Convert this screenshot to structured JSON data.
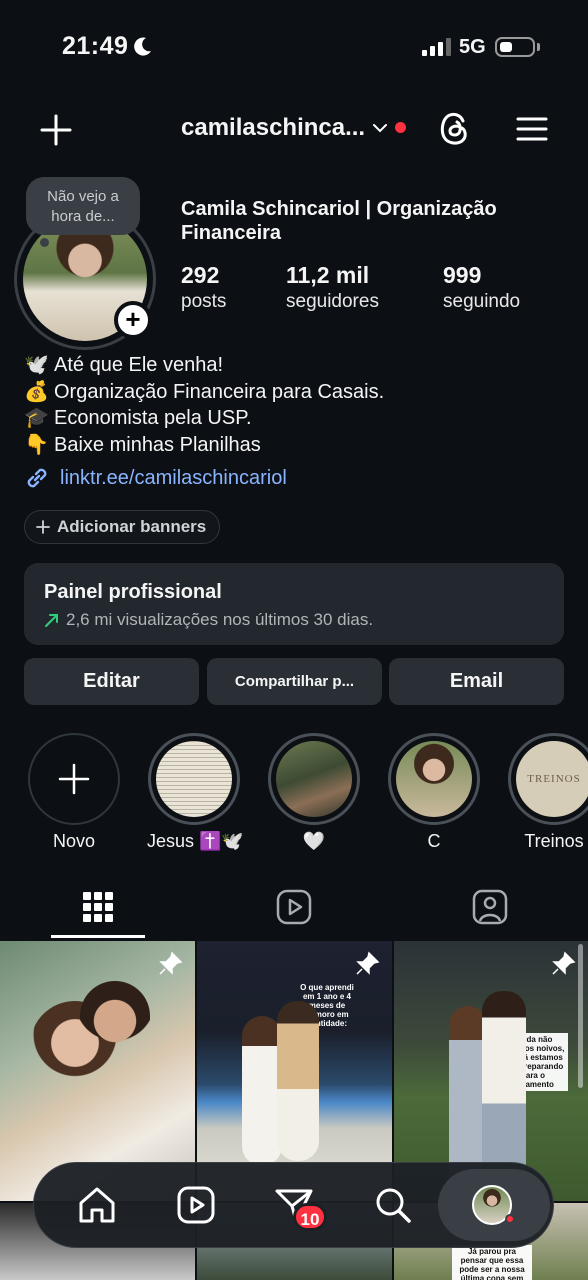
{
  "status": {
    "time": "21:49",
    "network": "5G"
  },
  "header": {
    "username": "camilaschinca..."
  },
  "profile": {
    "note": "Não vejo a hora de...",
    "display_name": "Camila Schincariol | Organização Financeira",
    "stats": [
      {
        "value": "292",
        "label": "posts"
      },
      {
        "value": "11,2 mil",
        "label": "seguidores"
      },
      {
        "value": "999",
        "label": "seguindo"
      }
    ],
    "bio": [
      {
        "emoji": "🕊️",
        "text": "Até que Ele venha!"
      },
      {
        "emoji": "💰",
        "text": "Organização Financeira para Casais."
      },
      {
        "emoji": "🎓",
        "text": "Economista pela USP."
      },
      {
        "emoji": "👇",
        "text": "Baixe minhas Planilhas"
      }
    ],
    "link": "linktr.ee/camilaschincariol",
    "add_banners": "Adicionar banners"
  },
  "pro_panel": {
    "title": "Painel profissional",
    "subtitle": "2,6 mi visualizações nos últimos 30 dias."
  },
  "actions": {
    "edit": "Editar",
    "share": "Compartilhar p...",
    "email": "Email"
  },
  "highlights": [
    {
      "label": "Novo"
    },
    {
      "label": "Jesus ✝️🕊️"
    },
    {
      "label": "🤍"
    },
    {
      "label": "C"
    },
    {
      "label": "Treinos",
      "cover_text": "TREINOS"
    }
  ],
  "posts": [
    {
      "overlay": ""
    },
    {
      "overlay": "O que aprendi em 1 ano e 4 meses de namoro em santidade:"
    },
    {
      "overlay": "Ainda não estamos noivos, mas já estamos nos preparando para o casamento"
    },
    {
      "overlay": ""
    },
    {
      "overlay": ""
    },
    {
      "overlay": "Já parou pra pensar que essa pode ser a nossa última copa sem filhos?!"
    }
  ],
  "nav": {
    "badge": "10"
  }
}
